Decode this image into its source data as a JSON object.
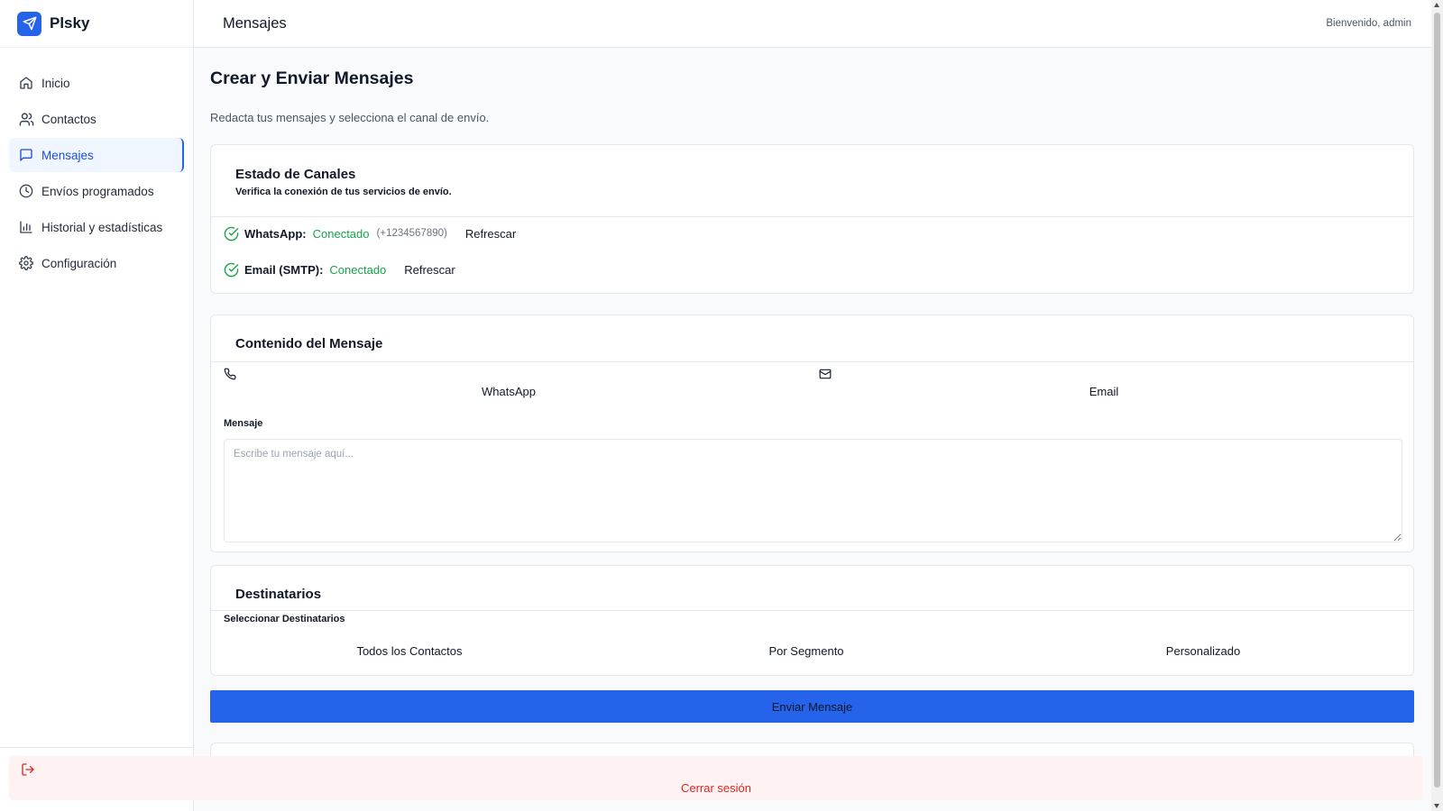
{
  "app": {
    "name": "Plsky"
  },
  "sidebar": {
    "items": [
      {
        "label": "Inicio",
        "icon": "home-icon",
        "active": false
      },
      {
        "label": "Contactos",
        "icon": "users-icon",
        "active": false
      },
      {
        "label": "Mensajes",
        "icon": "message-square-icon",
        "active": true
      },
      {
        "label": "Envíos programados",
        "icon": "clock-icon",
        "active": false
      },
      {
        "label": "Historial y estadísticas",
        "icon": "bar-chart-icon",
        "active": false
      },
      {
        "label": "Configuración",
        "icon": "gear-icon",
        "active": false
      }
    ],
    "logout_label": "Cerrar sesión"
  },
  "topbar": {
    "title": "Mensajes",
    "welcome": "Bienvenido, admin"
  },
  "page": {
    "title": "Crear y Enviar Mensajes",
    "subtitle": "Redacta tus mensajes y selecciona el canal de envío."
  },
  "channels_card": {
    "title": "Estado de Canales",
    "subtitle": "Verifica la conexión de tus servicios de envío.",
    "whatsapp": {
      "label": "WhatsApp:",
      "status": "Conectado",
      "phone": "(+1234567890)",
      "refresh": "Refrescar"
    },
    "email": {
      "label": "Email (SMTP):",
      "status": "Conectado",
      "refresh": "Refrescar"
    }
  },
  "content_card": {
    "title": "Contenido del Mensaje",
    "tabs": [
      {
        "label": "WhatsApp",
        "icon": "phone-icon"
      },
      {
        "label": "Email",
        "icon": "mail-icon"
      }
    ],
    "message_label": "Mensaje",
    "message_placeholder": "Escribe tu mensaje aquí...",
    "message_value": ""
  },
  "recipients_card": {
    "title": "Destinatarios",
    "select_label": "Seleccionar Destinatarios",
    "options": [
      "Todos los Contactos",
      "Por Segmento",
      "Personalizado"
    ]
  },
  "send_button": "Enviar Mensaje",
  "colors": {
    "primary": "#2563eb",
    "success": "#16a34a",
    "danger": "#dc2626"
  }
}
